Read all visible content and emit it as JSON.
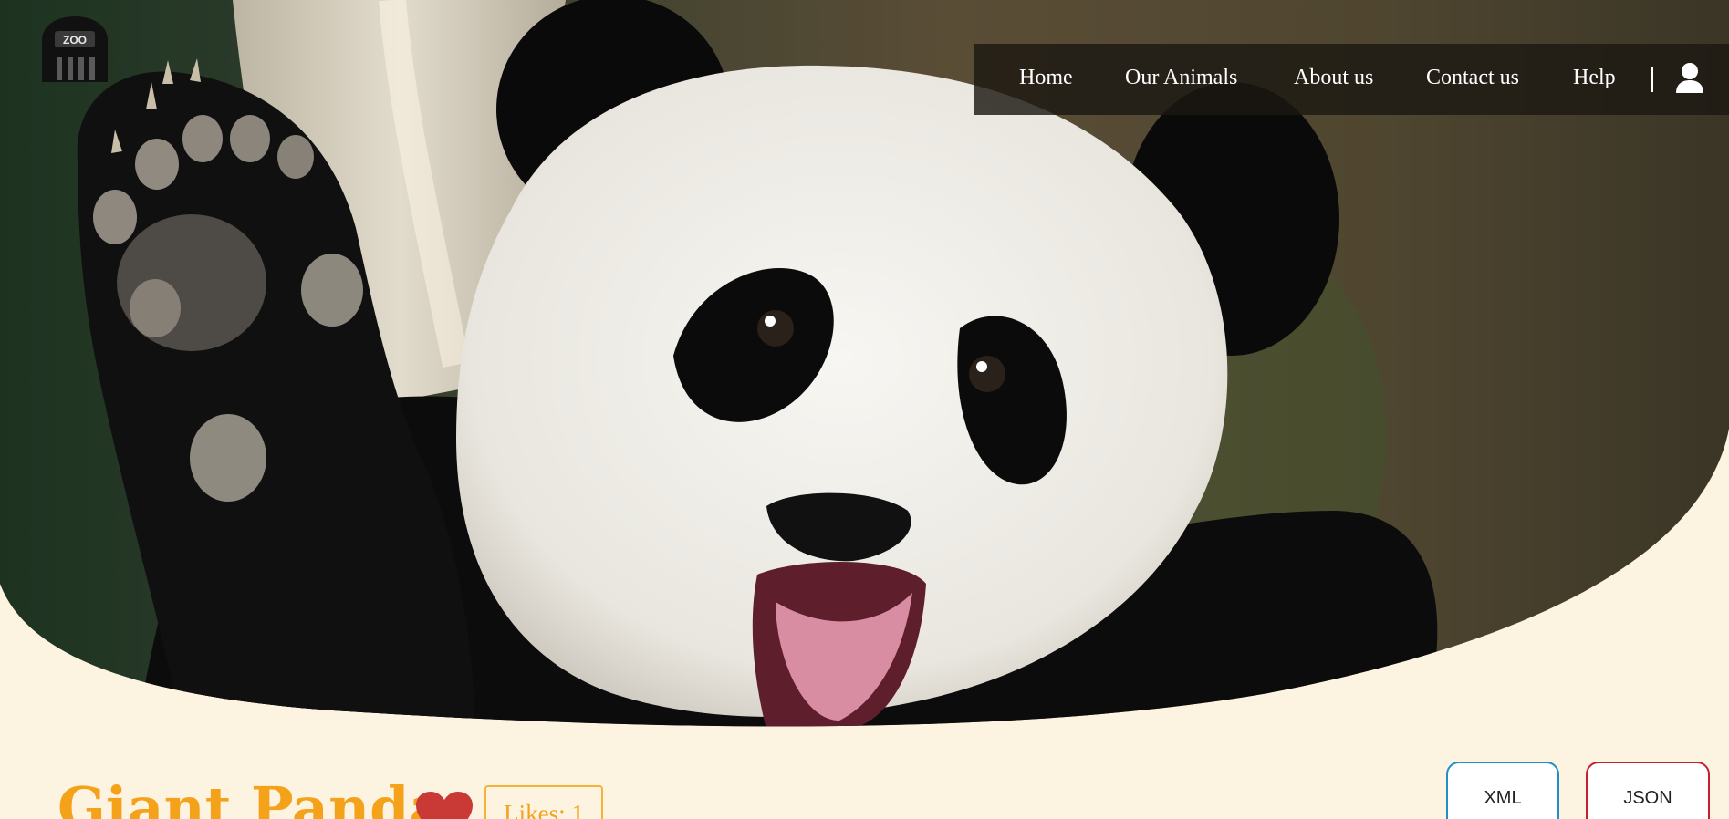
{
  "logo": {
    "icon": "zoo-gate-icon",
    "text": "ZOO"
  },
  "nav": {
    "links": [
      "Home",
      "Our Animals",
      "About us",
      "Contact us",
      "Help"
    ],
    "user_icon": "user-icon"
  },
  "hero": {
    "subject": "giant panda waving"
  },
  "animal": {
    "name": "Giant Panda",
    "likes_label": "Likes: 1",
    "heart_icon": "heart-icon"
  },
  "export": {
    "xml_label": "XML",
    "json_label": "JSON"
  },
  "colors": {
    "page_background": "#fdf3e1",
    "title_accent": "#f4a21a",
    "heart": "#c93a36",
    "xml_border": "#1f8fc9",
    "json_border": "#c4202f",
    "nav_background": "#1c1812"
  }
}
